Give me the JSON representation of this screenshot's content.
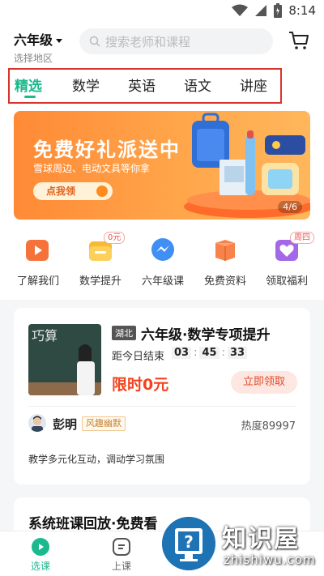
{
  "status_bar": {
    "time": "8:14"
  },
  "header": {
    "grade": "六年级",
    "region": "选择地区",
    "search_placeholder": "搜索老师和课程"
  },
  "tabs": [
    {
      "label": "精选",
      "active": true
    },
    {
      "label": "数学",
      "active": false
    },
    {
      "label": "英语",
      "active": false
    },
    {
      "label": "语文",
      "active": false
    },
    {
      "label": "讲座",
      "active": false
    }
  ],
  "banner": {
    "title": "免费好礼派送中",
    "subtitle": "雪球周边、电动文具等你拿",
    "button": "点我领",
    "page_indicator": "4/6"
  },
  "quick_entries": [
    {
      "label": "了解我们",
      "icon": "play-icon",
      "badge": ""
    },
    {
      "label": "数学提升",
      "icon": "folder-icon",
      "badge": "0元"
    },
    {
      "label": "六年级课",
      "icon": "messenger-icon",
      "badge": ""
    },
    {
      "label": "免费资料",
      "icon": "gift-box-icon",
      "badge": ""
    },
    {
      "label": "领取福利",
      "icon": "heart-icon",
      "badge": "周四"
    }
  ],
  "course": {
    "region_tag": "湖北",
    "title": "六年级·数学专项提升",
    "countdown_label": "距今日结束",
    "countdown": {
      "hours": "03",
      "minutes": "45",
      "seconds": "33"
    },
    "price": "限时0元",
    "claim_button": "立即领取",
    "teacher_name": "彭明",
    "teacher_tag": "风趣幽默",
    "popularity": "热度89997",
    "description": "教学多元化互动，调动学习氛围",
    "thumb_text": "巧算"
  },
  "section": {
    "title": "系统班课回放·免费看"
  },
  "bottom_nav": [
    {
      "label": "选课",
      "active": true
    },
    {
      "label": "上课",
      "active": false
    },
    {
      "label": "",
      "active": false
    },
    {
      "label": "",
      "active": false
    }
  ],
  "watermark": {
    "main": "知识屋",
    "sub": "zhishiwu.com"
  },
  "colors": {
    "accent": "#1bb98d",
    "price": "#f2431f",
    "banner": "#ff8a36",
    "highlight_box": "#d9322c"
  }
}
